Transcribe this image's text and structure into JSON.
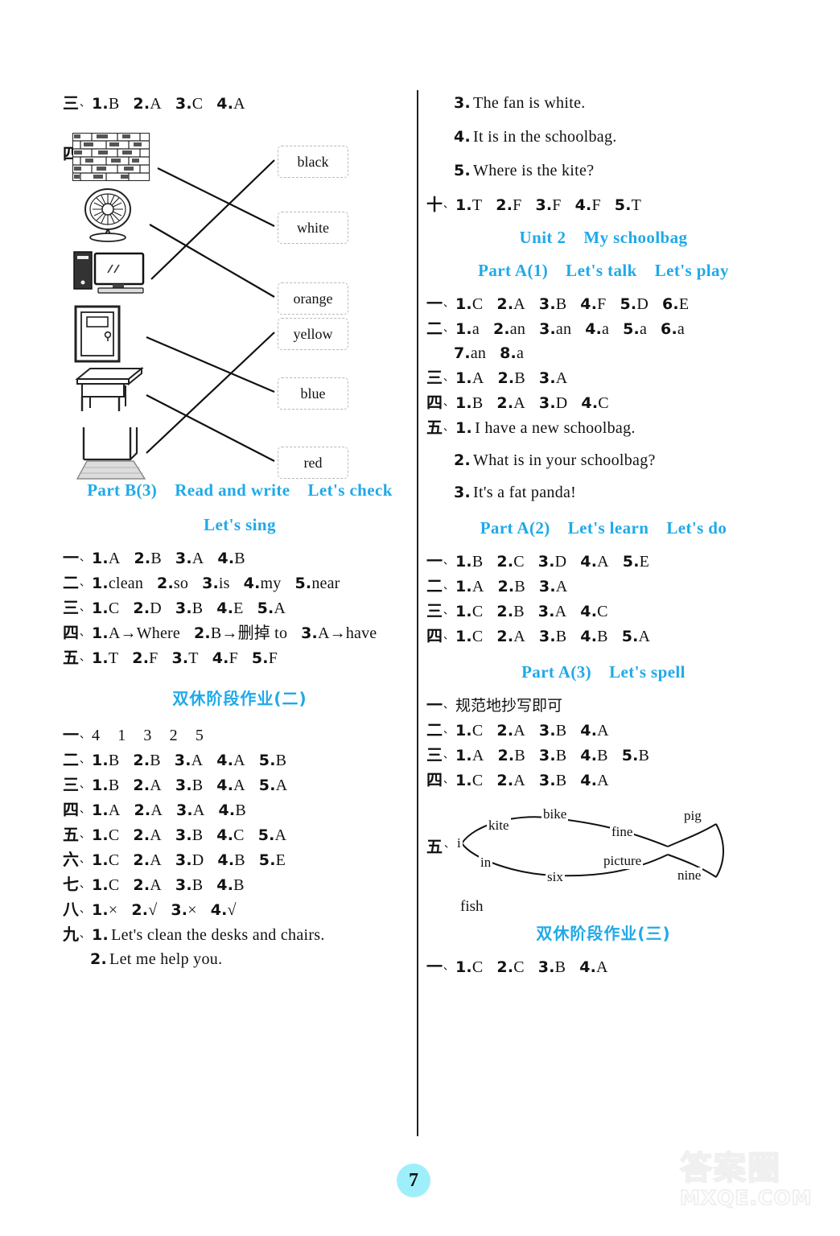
{
  "page": {
    "number": "7"
  },
  "watermark": {
    "cn": "答案圈",
    "en": "MXQE.COM"
  },
  "left_column": {
    "row_san": {
      "cnum": "三",
      "dun": "、",
      "items": [
        {
          "n": "1.",
          "v": "B"
        },
        {
          "n": "2.",
          "v": "A"
        },
        {
          "n": "3.",
          "v": "C"
        },
        {
          "n": "4.",
          "v": "A"
        }
      ]
    },
    "matching": {
      "cnum": "四",
      "dun": "、",
      "pictures": [
        {
          "name": "wall",
          "label": "wall"
        },
        {
          "name": "fan",
          "label": "fan"
        },
        {
          "name": "computer",
          "label": "computer"
        },
        {
          "name": "door",
          "label": "door"
        },
        {
          "name": "desk",
          "label": "desk"
        },
        {
          "name": "floor",
          "label": "floor"
        }
      ],
      "words": [
        "black",
        "white",
        "orange",
        "yellow",
        "blue",
        "red"
      ],
      "connections": [
        {
          "from": "wall",
          "to": "white"
        },
        {
          "from": "fan",
          "to": "orange"
        },
        {
          "from": "computer",
          "to": "black"
        },
        {
          "from": "door",
          "to": "blue"
        },
        {
          "from": "desk",
          "to": "red"
        },
        {
          "from": "floor",
          "to": "yellow"
        }
      ]
    },
    "heading_partB3": {
      "a": "Part B(3)",
      "b": "Read and write",
      "c": "Let's check"
    },
    "heading_letssing": "Let's sing",
    "partB3_answers": [
      {
        "cnum": "一",
        "dun": "、",
        "items": [
          {
            "n": "1.",
            "v": "A"
          },
          {
            "n": "2.",
            "v": "B"
          },
          {
            "n": "3.",
            "v": "A"
          },
          {
            "n": "4.",
            "v": "B"
          }
        ]
      },
      {
        "cnum": "二",
        "dun": "、",
        "items": [
          {
            "n": "1.",
            "v": "clean"
          },
          {
            "n": "2.",
            "v": "so"
          },
          {
            "n": "3.",
            "v": "is"
          },
          {
            "n": "4.",
            "v": "my"
          },
          {
            "n": "5.",
            "v": "near"
          }
        ]
      },
      {
        "cnum": "三",
        "dun": "、",
        "items": [
          {
            "n": "1.",
            "v": "C"
          },
          {
            "n": "2.",
            "v": "D"
          },
          {
            "n": "3.",
            "v": "B"
          },
          {
            "n": "4.",
            "v": "E"
          },
          {
            "n": "5.",
            "v": "A"
          }
        ]
      },
      {
        "cnum": "四",
        "dun": "、",
        "items": [
          {
            "n": "1.",
            "v": "A→Where"
          },
          {
            "n": "2.",
            "v": "B→删掉 to"
          },
          {
            "n": "3.",
            "v": "A→have"
          }
        ]
      },
      {
        "cnum": "五",
        "dun": "、",
        "items": [
          {
            "n": "1.",
            "v": "T"
          },
          {
            "n": "2.",
            "v": "F"
          },
          {
            "n": "3.",
            "v": "T"
          },
          {
            "n": "4.",
            "v": "F"
          },
          {
            "n": "5.",
            "v": "F"
          }
        ]
      }
    ],
    "heading_homework2": "双休阶段作业(二)",
    "homework2_answers": [
      {
        "cnum": "一",
        "dun": "、",
        "plain": [
          "4",
          "1",
          "3",
          "2",
          "5"
        ]
      },
      {
        "cnum": "二",
        "dun": "、",
        "items": [
          {
            "n": "1.",
            "v": "B"
          },
          {
            "n": "2.",
            "v": "B"
          },
          {
            "n": "3.",
            "v": "A"
          },
          {
            "n": "4.",
            "v": "A"
          },
          {
            "n": "5.",
            "v": "B"
          }
        ]
      },
      {
        "cnum": "三",
        "dun": "、",
        "items": [
          {
            "n": "1.",
            "v": "B"
          },
          {
            "n": "2.",
            "v": "A"
          },
          {
            "n": "3.",
            "v": "B"
          },
          {
            "n": "4.",
            "v": "A"
          },
          {
            "n": "5.",
            "v": "A"
          }
        ]
      },
      {
        "cnum": "四",
        "dun": "、",
        "items": [
          {
            "n": "1.",
            "v": "A"
          },
          {
            "n": "2.",
            "v": "A"
          },
          {
            "n": "3.",
            "v": "A"
          },
          {
            "n": "4.",
            "v": "B"
          }
        ]
      },
      {
        "cnum": "五",
        "dun": "、",
        "items": [
          {
            "n": "1.",
            "v": "C"
          },
          {
            "n": "2.",
            "v": "A"
          },
          {
            "n": "3.",
            "v": "B"
          },
          {
            "n": "4.",
            "v": "C"
          },
          {
            "n": "5.",
            "v": "A"
          }
        ]
      },
      {
        "cnum": "六",
        "dun": "、",
        "items": [
          {
            "n": "1.",
            "v": "C"
          },
          {
            "n": "2.",
            "v": "A"
          },
          {
            "n": "3.",
            "v": "D"
          },
          {
            "n": "4.",
            "v": "B"
          },
          {
            "n": "5.",
            "v": "E"
          }
        ]
      },
      {
        "cnum": "七",
        "dun": "、",
        "items": [
          {
            "n": "1.",
            "v": "C"
          },
          {
            "n": "2.",
            "v": "A"
          },
          {
            "n": "3.",
            "v": "B"
          },
          {
            "n": "4.",
            "v": "B"
          }
        ]
      },
      {
        "cnum": "八",
        "dun": "、",
        "items": [
          {
            "n": "1.",
            "v": "×"
          },
          {
            "n": "2.",
            "v": "√"
          },
          {
            "n": "3.",
            "v": "×"
          },
          {
            "n": "4.",
            "v": "√"
          }
        ]
      }
    ],
    "homework2_jiu": {
      "cnum": "九",
      "dun": "、",
      "lines": [
        {
          "n": "1.",
          "text": "Let's clean the desks and chairs."
        },
        {
          "n": "2.",
          "text": "Let me help you."
        }
      ]
    }
  },
  "right_column": {
    "top_sentences": [
      {
        "n": "3.",
        "text": "The fan is white."
      },
      {
        "n": "4.",
        "text": "It is in the schoolbag."
      },
      {
        "n": "5.",
        "text": "Where is the kite?"
      }
    ],
    "row_shi": {
      "cnum": "十",
      "dun": "、",
      "items": [
        {
          "n": "1.",
          "v": "T"
        },
        {
          "n": "2.",
          "v": "F"
        },
        {
          "n": "3.",
          "v": "F"
        },
        {
          "n": "4.",
          "v": "F"
        },
        {
          "n": "5.",
          "v": "T"
        }
      ]
    },
    "heading_unit2": {
      "a": "Unit 2",
      "b": "My schoolbag"
    },
    "heading_partA1": {
      "a": "Part A(1)",
      "b": "Let's talk",
      "c": "Let's play"
    },
    "partA1_answers": [
      {
        "cnum": "一",
        "dun": "、",
        "items": [
          {
            "n": "1.",
            "v": "C"
          },
          {
            "n": "2.",
            "v": "A"
          },
          {
            "n": "3.",
            "v": "B"
          },
          {
            "n": "4.",
            "v": "F"
          },
          {
            "n": "5.",
            "v": "D"
          },
          {
            "n": "6.",
            "v": "E"
          }
        ]
      },
      {
        "cnum": "二",
        "dun": "、",
        "items": [
          {
            "n": "1.",
            "v": "a"
          },
          {
            "n": "2.",
            "v": "an"
          },
          {
            "n": "3.",
            "v": "an"
          },
          {
            "n": "4.",
            "v": "a"
          },
          {
            "n": "5.",
            "v": "a"
          },
          {
            "n": "6.",
            "v": "a"
          }
        ]
      }
    ],
    "partA1_er_cont": {
      "items": [
        {
          "n": "7.",
          "v": "an"
        },
        {
          "n": "8.",
          "v": "a"
        }
      ]
    },
    "partA1_answers2": [
      {
        "cnum": "三",
        "dun": "、",
        "items": [
          {
            "n": "1.",
            "v": "A"
          },
          {
            "n": "2.",
            "v": "B"
          },
          {
            "n": "3.",
            "v": "A"
          }
        ]
      },
      {
        "cnum": "四",
        "dun": "、",
        "items": [
          {
            "n": "1.",
            "v": "B"
          },
          {
            "n": "2.",
            "v": "A"
          },
          {
            "n": "3.",
            "v": "D"
          },
          {
            "n": "4.",
            "v": "C"
          }
        ]
      }
    ],
    "partA1_wu": {
      "cnum": "五",
      "dun": "、",
      "lines": [
        {
          "n": "1.",
          "text": "I have a new schoolbag."
        },
        {
          "n": "2.",
          "text": "What is in your schoolbag?"
        },
        {
          "n": "3.",
          "text": "It's a fat panda!"
        }
      ]
    },
    "heading_partA2": {
      "a": "Part A(2)",
      "b": "Let's learn",
      "c": "Let's do"
    },
    "partA2_answers": [
      {
        "cnum": "一",
        "dun": "、",
        "items": [
          {
            "n": "1.",
            "v": "B"
          },
          {
            "n": "2.",
            "v": "C"
          },
          {
            "n": "3.",
            "v": "D"
          },
          {
            "n": "4.",
            "v": "A"
          },
          {
            "n": "5.",
            "v": "E"
          }
        ]
      },
      {
        "cnum": "二",
        "dun": "、",
        "items": [
          {
            "n": "1.",
            "v": "A"
          },
          {
            "n": "2.",
            "v": "B"
          },
          {
            "n": "3.",
            "v": "A"
          }
        ]
      },
      {
        "cnum": "三",
        "dun": "、",
        "items": [
          {
            "n": "1.",
            "v": "C"
          },
          {
            "n": "2.",
            "v": "B"
          },
          {
            "n": "3.",
            "v": "A"
          },
          {
            "n": "4.",
            "v": "C"
          }
        ]
      },
      {
        "cnum": "四",
        "dun": "、",
        "items": [
          {
            "n": "1.",
            "v": "C"
          },
          {
            "n": "2.",
            "v": "A"
          },
          {
            "n": "3.",
            "v": "B"
          },
          {
            "n": "4.",
            "v": "B"
          },
          {
            "n": "5.",
            "v": "A"
          }
        ]
      }
    ],
    "heading_partA3": {
      "a": "Part A(3)",
      "b": "Let's spell"
    },
    "partA3_yi": {
      "cnum": "一",
      "dun": "、",
      "text": "规范地抄写即可"
    },
    "partA3_answers": [
      {
        "cnum": "二",
        "dun": "、",
        "items": [
          {
            "n": "1.",
            "v": "C"
          },
          {
            "n": "2.",
            "v": "A"
          },
          {
            "n": "3.",
            "v": "B"
          },
          {
            "n": "4.",
            "v": "A"
          }
        ]
      },
      {
        "cnum": "三",
        "dun": "、",
        "items": [
          {
            "n": "1.",
            "v": "A"
          },
          {
            "n": "2.",
            "v": "B"
          },
          {
            "n": "3.",
            "v": "B"
          },
          {
            "n": "4.",
            "v": "B"
          },
          {
            "n": "5.",
            "v": "B"
          }
        ]
      },
      {
        "cnum": "四",
        "dun": "、",
        "items": [
          {
            "n": "1.",
            "v": "C"
          },
          {
            "n": "2.",
            "v": "A"
          },
          {
            "n": "3.",
            "v": "B"
          },
          {
            "n": "4.",
            "v": "A"
          }
        ]
      }
    ],
    "fish": {
      "cnum": "五",
      "dun": "、",
      "start": "i",
      "upper_path": [
        "kite",
        "bike",
        "fine",
        "pig"
      ],
      "lower_path": [
        "in",
        "six",
        "picture",
        "nine"
      ],
      "answer": "fish"
    },
    "heading_homework3": "双休阶段作业(三)",
    "homework3_answers": [
      {
        "cnum": "一",
        "dun": "、",
        "items": [
          {
            "n": "1.",
            "v": "C"
          },
          {
            "n": "2.",
            "v": "C"
          },
          {
            "n": "3.",
            "v": "B"
          },
          {
            "n": "4.",
            "v": "A"
          }
        ]
      }
    ]
  }
}
